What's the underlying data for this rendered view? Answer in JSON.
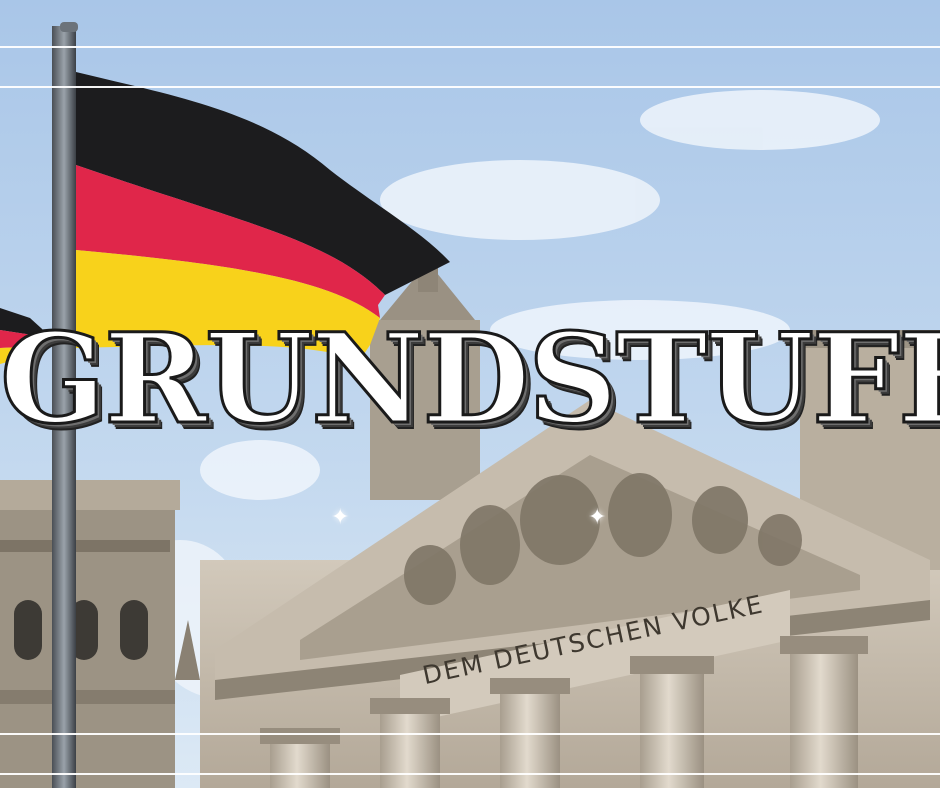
{
  "headline": "GRUNDSTUFE",
  "inscription": "DEM DEUTSCHEN VOLKE",
  "sparkle_glyph": "✦",
  "colors": {
    "sky_top": "#a9c6e8",
    "sky_bottom": "#d6e6f4",
    "flag_black": "#1c1c1e",
    "flag_red": "#e0264a",
    "flag_gold": "#f8d21b",
    "stone": "#c9bfb0",
    "stone_dark": "#8f8677",
    "title_fill": "#ffffff",
    "title_outline": "#1a1a1a"
  },
  "icons": [
    "german-flag",
    "flagpole",
    "sparkle-icon"
  ]
}
